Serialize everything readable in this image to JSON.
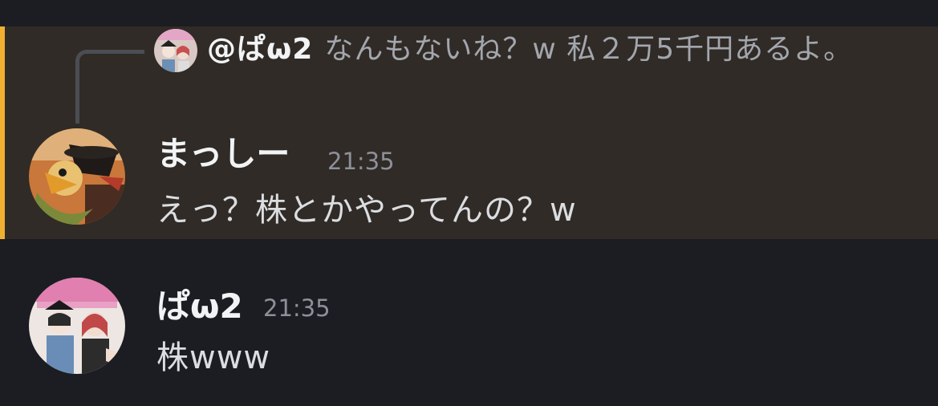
{
  "messages": [
    {
      "reply": {
        "author": "@ぱω2",
        "text": "なんもないね？w 私２万5千円あるよ。"
      },
      "author": "まっしー",
      "timestamp": "21:35",
      "content": "えっ？株とかやってんの？w",
      "highlighted": true
    },
    {
      "author": "ぱω2",
      "timestamp": "21:35",
      "content": "株www",
      "highlighted": false
    }
  ],
  "colors": {
    "background": "#1c1d22",
    "highlight_background": "#302b26",
    "highlight_accent": "#f0b132",
    "author_text": "#f2f3f5",
    "timestamp_text": "#8e9099",
    "message_text": "#dbdde1",
    "reply_text": "#a3a6ae"
  },
  "icons": {
    "avatar_1": "avatar-illustration-bird-hat",
    "avatar_2": "avatar-illustration-two-characters"
  }
}
